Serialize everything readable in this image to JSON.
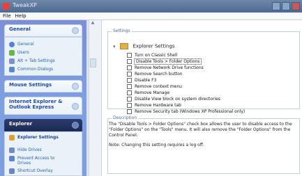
{
  "window": {
    "title": "TweakXP"
  },
  "menu": {
    "items": [
      "File",
      "Help"
    ]
  },
  "sidebar": {
    "groups": [
      {
        "title": "General",
        "items": [
          "General",
          "Users",
          "Alt + Tab Settings",
          "Common Dialogs"
        ]
      },
      {
        "title": "Mouse Settings",
        "items": []
      },
      {
        "title": "Internet Explorer & Outlook Express",
        "items": []
      },
      {
        "title": "Explorer",
        "items": [
          "Explorer Settings",
          "Hide Drives",
          "Prevent Access to Drives",
          "Shortcut Overlay"
        ]
      }
    ]
  },
  "settings": {
    "label": "Settings",
    "root": "Explorer Settings",
    "items": [
      "Turn on Classic Shell",
      "Disable Tools > Folder Options",
      "Remove Network Drive functions",
      "Remove Search button",
      "Disable F3",
      "Remove context menu",
      "Remove Manage",
      "Disable View block on system directories",
      "Remove Hardware tab",
      "Remove Security tab (Windows XP Professional only)"
    ]
  },
  "description": {
    "label": "Description",
    "text": "The \"Disable Tools > Folder Options\" check box allows the user to disable access to the \"Folder Options\" on the \"Tools\" menu. It will also remove the \"Folder Options\" from the Control Panel.",
    "note": "Note: Changing this setting requires a log off."
  }
}
